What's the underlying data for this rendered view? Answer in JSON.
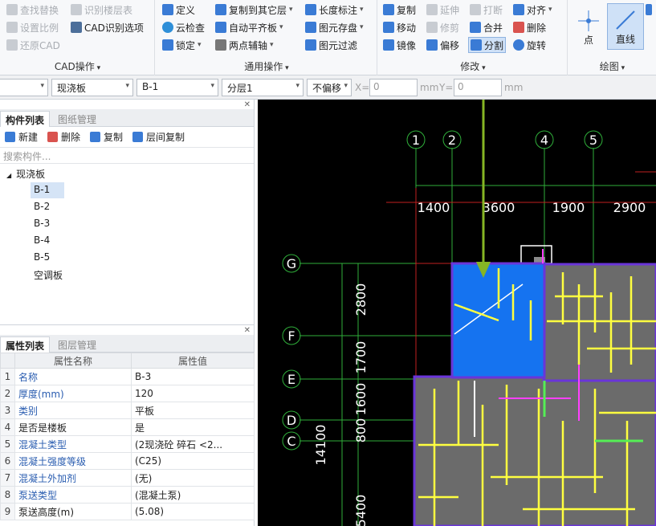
{
  "ribbon": {
    "cad_ops": {
      "items": [
        "查找替换",
        "识别楼层表",
        "设置比例",
        "CAD识别选项",
        "还原CAD"
      ],
      "label": "CAD操作"
    },
    "common_ops": {
      "items": [
        "定义",
        "复制到其它层",
        "长度标注",
        "云检查",
        "自动平齐板",
        "图元存盘",
        "锁定",
        "两点辅轴",
        "图元过滤"
      ],
      "label": "通用操作"
    },
    "modify": {
      "items": [
        "复制",
        "延伸",
        "打断",
        "对齐",
        "移动",
        "修剪",
        "合并",
        "删除",
        "镜像",
        "偏移",
        "分割",
        "旋转"
      ],
      "label": "修改"
    },
    "draw": {
      "items": [
        "点",
        "直线"
      ],
      "label": "绘图"
    }
  },
  "toolbar2": {
    "sel1": "",
    "sel2": "现浇板",
    "sel3": "B-1",
    "sel4": "分层1",
    "sel5": "不偏移",
    "x_label": "X=",
    "x_value": "0",
    "unit1": "mm",
    "y_label": "Y=",
    "y_value": "0",
    "unit2": "mm"
  },
  "component_panel": {
    "tabs": [
      "构件列表",
      "图纸管理"
    ],
    "actions": [
      "新建",
      "删除",
      "复制",
      "层间复制"
    ],
    "search_placeholder": "搜索构件...",
    "tree_root": "现浇板",
    "items": [
      "B-1",
      "B-2",
      "B-3",
      "B-4",
      "B-5",
      "空调板"
    ],
    "selected": "B-1"
  },
  "property_panel": {
    "tabs": [
      "属性列表",
      "图层管理"
    ],
    "headers": [
      "属性名称",
      "属性值"
    ],
    "rows": [
      {
        "n": "1",
        "name": "名称",
        "value": "B-3",
        "blue": true
      },
      {
        "n": "2",
        "name": "厚度(mm)",
        "value": "120",
        "blue": true
      },
      {
        "n": "3",
        "name": "类别",
        "value": "平板",
        "blue": true
      },
      {
        "n": "4",
        "name": "是否是楼板",
        "value": "是",
        "blue": false
      },
      {
        "n": "5",
        "name": "混凝土类型",
        "value": "(2现浇砼 碎石 <2...",
        "blue": true
      },
      {
        "n": "6",
        "name": "混凝土强度等级",
        "value": "(C25)",
        "blue": true
      },
      {
        "n": "7",
        "name": "混凝土外加剂",
        "value": "(无)",
        "blue": true
      },
      {
        "n": "8",
        "name": "泵送类型",
        "value": "(混凝土泵)",
        "blue": true
      },
      {
        "n": "9",
        "name": "泵送高度(m)",
        "value": "(5.08)",
        "blue": false
      }
    ]
  },
  "drawing": {
    "col_axes": [
      "1",
      "2",
      "4",
      "5"
    ],
    "row_axes": [
      "G",
      "F",
      "E",
      "D",
      "C"
    ],
    "top_dims": [
      "1400",
      "3600",
      "1900",
      "2900"
    ],
    "left_dims": [
      "2800",
      "1700",
      "1600",
      "800"
    ],
    "overall_dim": "14100",
    "bottom_dim": "5400"
  }
}
